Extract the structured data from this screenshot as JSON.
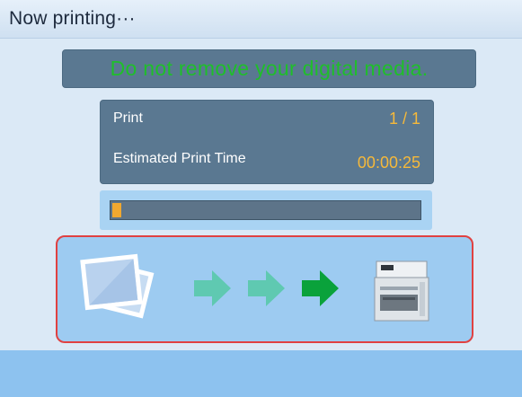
{
  "title": "Now printing···",
  "warning": "Do not remove your digital media.",
  "info": {
    "print_label": "Print",
    "print_count": "1 / 1",
    "time_label": "Estimated Print Time",
    "time_value": "00:00:25"
  },
  "progress": {
    "fraction": 0.03,
    "fill_color": "#f0a830"
  },
  "animation": {
    "source_icon": "photos-icon",
    "arrows": [
      "arrow-right-icon",
      "arrow-right-icon",
      "arrow-right-icon"
    ],
    "arrow_colors": [
      "#5fc9b1",
      "#5fc9b1",
      "#0aa23b"
    ],
    "target_icon": "printer-icon"
  },
  "colors": {
    "warning_text": "#1fbf2a",
    "value_text": "#f6b93a",
    "panel": "#5a7891",
    "highlight_border": "#e04141"
  }
}
